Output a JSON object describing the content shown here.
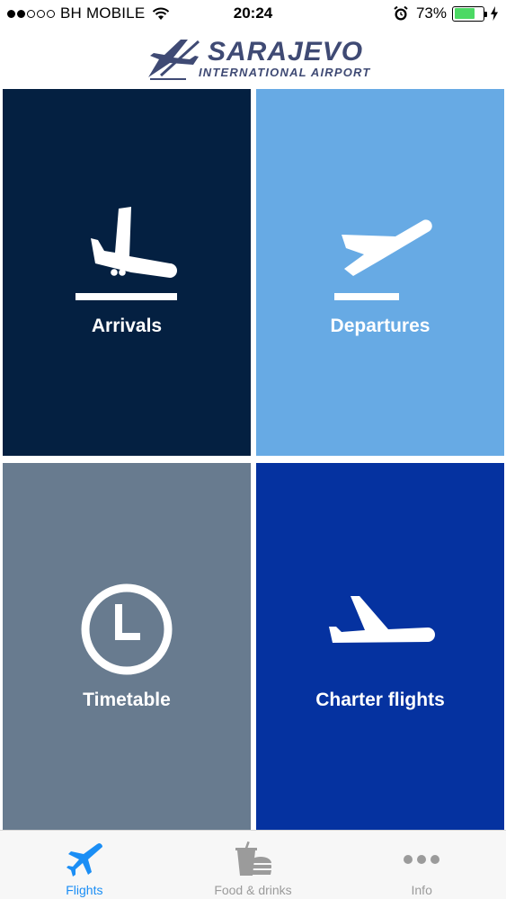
{
  "status_bar": {
    "carrier": "BH MOBILE",
    "signal_strength": 2,
    "signal_max": 5,
    "time": "20:24",
    "battery_percent": "73%",
    "battery_level": 0.73,
    "icons": [
      "wifi-icon",
      "alarm-icon",
      "battery-icon",
      "charging-icon"
    ]
  },
  "header": {
    "logo_title": "SARAJEVO",
    "logo_subtitle": "INTERNATIONAL AIRPORT"
  },
  "tiles": [
    {
      "label": "Arrivals",
      "icon": "plane-landing-icon",
      "color": "#042041"
    },
    {
      "label": "Departures",
      "icon": "plane-takeoff-icon",
      "color": "#67aae4"
    },
    {
      "label": "Timetable",
      "icon": "clock-icon",
      "color": "#687b8f"
    },
    {
      "label": "Charter flights",
      "icon": "plane-icon",
      "color": "#0532a0"
    }
  ],
  "tab_bar": {
    "tabs": [
      {
        "label": "Flights",
        "icon": "plane-icon",
        "active": true
      },
      {
        "label": "Food & drinks",
        "icon": "food-drink-icon",
        "active": false
      },
      {
        "label": "Info",
        "icon": "more-dots-icon",
        "active": false
      }
    ],
    "active_color": "#1b8ef5",
    "inactive_color": "#9b9b9b"
  }
}
